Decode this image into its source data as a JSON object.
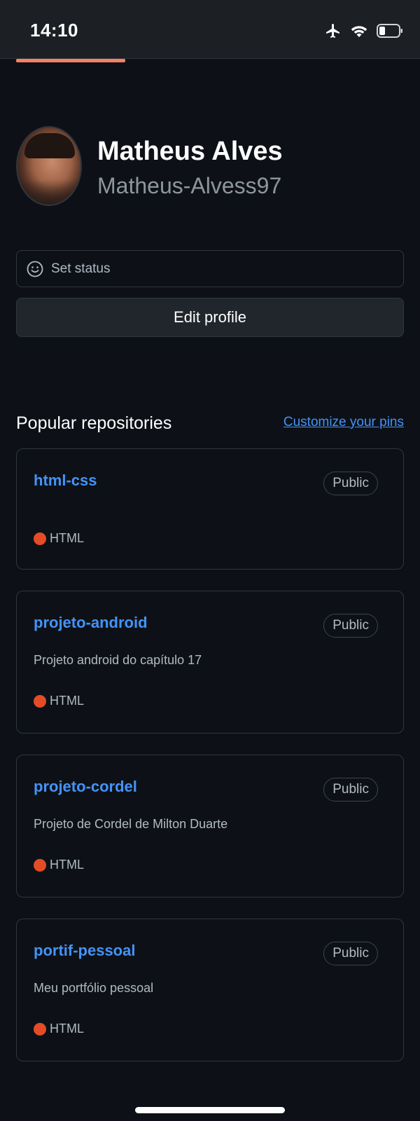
{
  "status_bar": {
    "time": "14:10",
    "icons": [
      "airplane-icon",
      "wifi-icon",
      "battery-icon"
    ]
  },
  "profile": {
    "name": "Matheus Alves",
    "login": "Matheus-Alvess97",
    "set_status_label": "Set status",
    "edit_profile_label": "Edit profile"
  },
  "popular": {
    "title": "Popular repositories",
    "customize_label": "Customize your pins",
    "repos": [
      {
        "name": "html-css",
        "visibility": "Public",
        "description": "",
        "language": "HTML",
        "language_color": "#e34c26"
      },
      {
        "name": "projeto-android",
        "visibility": "Public",
        "description": "Projeto android do capítulo 17",
        "language": "HTML",
        "language_color": "#e34c26"
      },
      {
        "name": "projeto-cordel",
        "visibility": "Public",
        "description": "Projeto de Cordel de Milton Duarte",
        "language": "HTML",
        "language_color": "#e34c26"
      },
      {
        "name": "portif-pessoal",
        "visibility": "Public",
        "description": "Meu portfólio pessoal",
        "language": "HTML",
        "language_color": "#e34c26"
      }
    ]
  },
  "colors": {
    "background": "#0d1117",
    "link": "#4493f8",
    "accent_tab": "#f78166",
    "border": "#30363d"
  }
}
